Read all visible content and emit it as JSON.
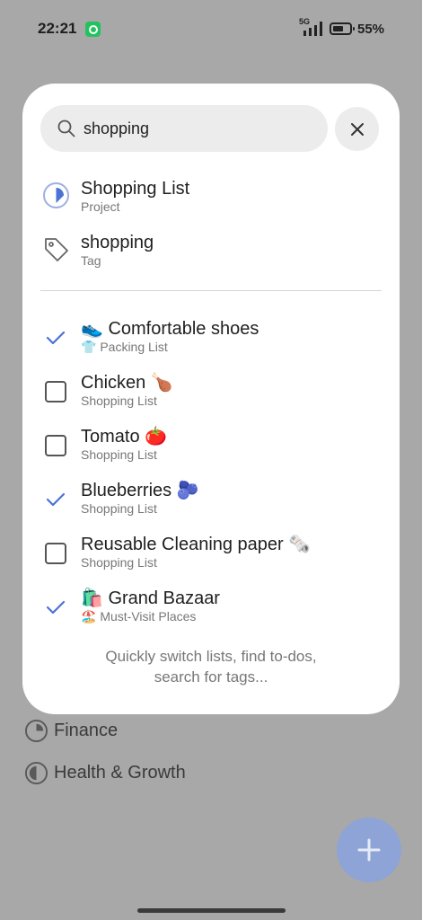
{
  "status": {
    "time": "22:21",
    "network": "5G",
    "battery": "55%"
  },
  "search": {
    "query": "shopping"
  },
  "results": [
    {
      "title": "Shopping List",
      "subtitle": "Project",
      "icon": "project-pie-icon"
    },
    {
      "title": "shopping",
      "subtitle": "Tag",
      "icon": "tag-icon"
    }
  ],
  "todos": [
    {
      "title": "👟 Comfortable shoes",
      "list": "👕 Packing List",
      "checked": true
    },
    {
      "title": "Chicken 🍗",
      "list": "Shopping List",
      "checked": false
    },
    {
      "title": "Tomato 🍅",
      "list": "Shopping List",
      "checked": false
    },
    {
      "title": "Blueberries 🫐",
      "list": "Shopping List",
      "checked": true
    },
    {
      "title": "Reusable Cleaning paper 🗞️",
      "list": "Shopping List",
      "checked": false
    },
    {
      "title": "🛍️ Grand Bazaar",
      "list": "🏖️ Must-Visit Places",
      "checked": true
    }
  ],
  "hint": {
    "line1": "Quickly switch lists, find to-dos,",
    "line2": "search for tags..."
  },
  "background": {
    "item1": "Finance",
    "item2": "Health & Growth"
  },
  "colors": {
    "accent": "#4a73d6",
    "card": "#ffffff",
    "scrim": "#a8a8a8",
    "fab": "#8ea3d6"
  }
}
